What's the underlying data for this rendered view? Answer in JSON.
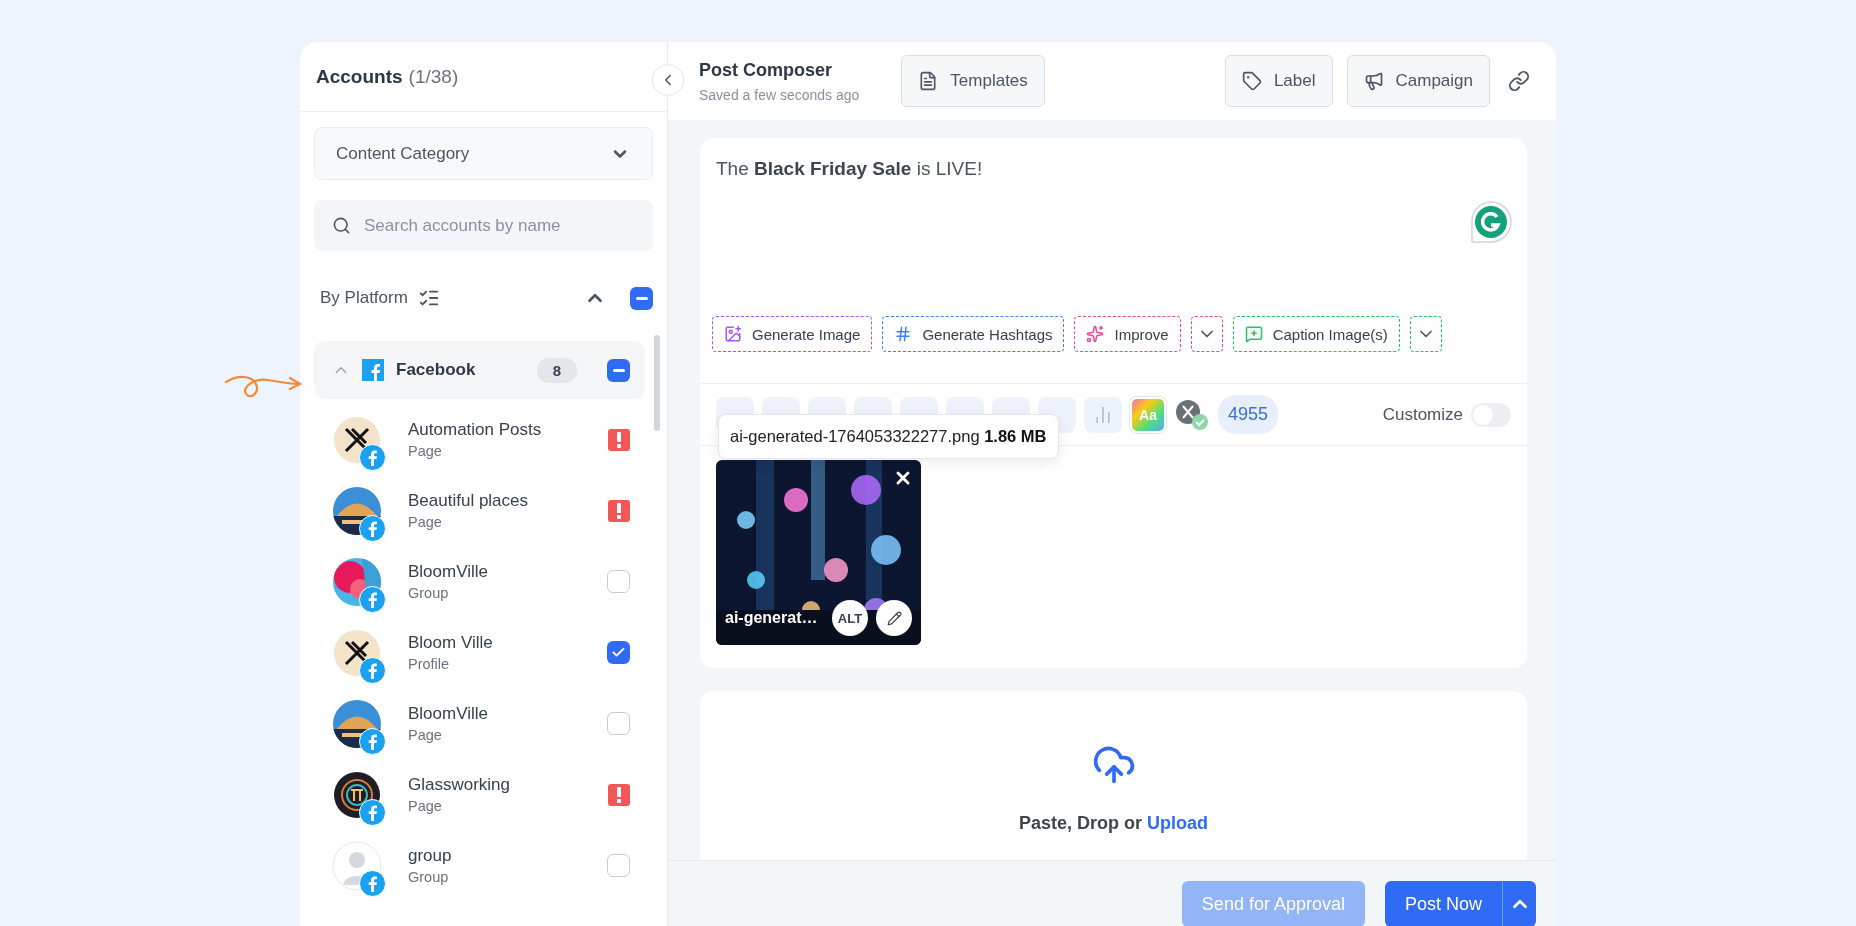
{
  "sidebar": {
    "title": "Accounts",
    "count": "(1/38)",
    "category_dropdown": {
      "value": "Content Category"
    },
    "search": {
      "placeholder": "Search accounts by name"
    },
    "group_by": {
      "label": "By Platform",
      "expanded": true,
      "partially_selected": true
    },
    "platform_groups": [
      {
        "name": "Facebook",
        "count": "8",
        "expanded": true,
        "partially_selected": true,
        "accounts": [
          {
            "name": "Automation Posts",
            "type": "Page",
            "avatar": {
              "kind": "logo"
            },
            "kind": "alert"
          },
          {
            "name": "Beautiful places",
            "type": "Page",
            "kind": "alert"
          },
          {
            "name": "BloomVille",
            "type": "Group",
            "kind": "checkbox",
            "checked": false
          },
          {
            "name": "Bloom Ville",
            "type": "Profile",
            "avatar": {
              "kind": "logo"
            },
            "kind": "checkbox",
            "checked": true
          },
          {
            "name": "BloomVille",
            "type": "Page",
            "kind": "checkbox",
            "checked": false
          },
          {
            "name": "Glassworking",
            "type": "Page",
            "avatar": {
              "kind": "logo"
            },
            "kind": "alert"
          },
          {
            "name": "group",
            "type": "Group",
            "avatar": {
              "kind": "placeholder"
            },
            "kind": "checkbox",
            "checked": false
          }
        ]
      }
    ]
  },
  "composer": {
    "title": "Post Composer",
    "subtitle": "Saved a few seconds ago",
    "buttons": [
      "Templates",
      "Label",
      "Campaign"
    ],
    "post_text": "The **Black Friday Sale** is LIVE!",
    "ai_actions": [
      {
        "kind": "action",
        "label": "Generate Image",
        "color": "#a855f7"
      },
      {
        "kind": "action",
        "label": "Generate Hashtags",
        "color": "#3b82f6"
      },
      {
        "kind": "action",
        "label": "Improve",
        "color": "#ec4899"
      },
      {
        "kind": "menu",
        "color": "#ec4899"
      },
      {
        "kind": "action",
        "label": "Caption Image(s)",
        "color": "#22c55e"
      },
      {
        "kind": "menu",
        "color": "#22c55e"
      }
    ],
    "toolbar": {
      "font_button": "Aa",
      "character_count": "4955",
      "customize": {
        "label": "Customize",
        "on": false
      }
    },
    "tooltip": "ai-generated-1764053322277.png **1.86 MB**",
    "media": [
      {
        "caption": "ai-generat…",
        "alt_button": "ALT",
        "kind": "picture"
      }
    ],
    "upload": {
      "text": "Paste, Drop or",
      "link": "Upload"
    }
  },
  "footer": {
    "buttons": [
      {
        "label": "Send for Approval",
        "disabled": true
      },
      {
        "label": "Post Now",
        "disabled": false
      }
    ]
  }
}
